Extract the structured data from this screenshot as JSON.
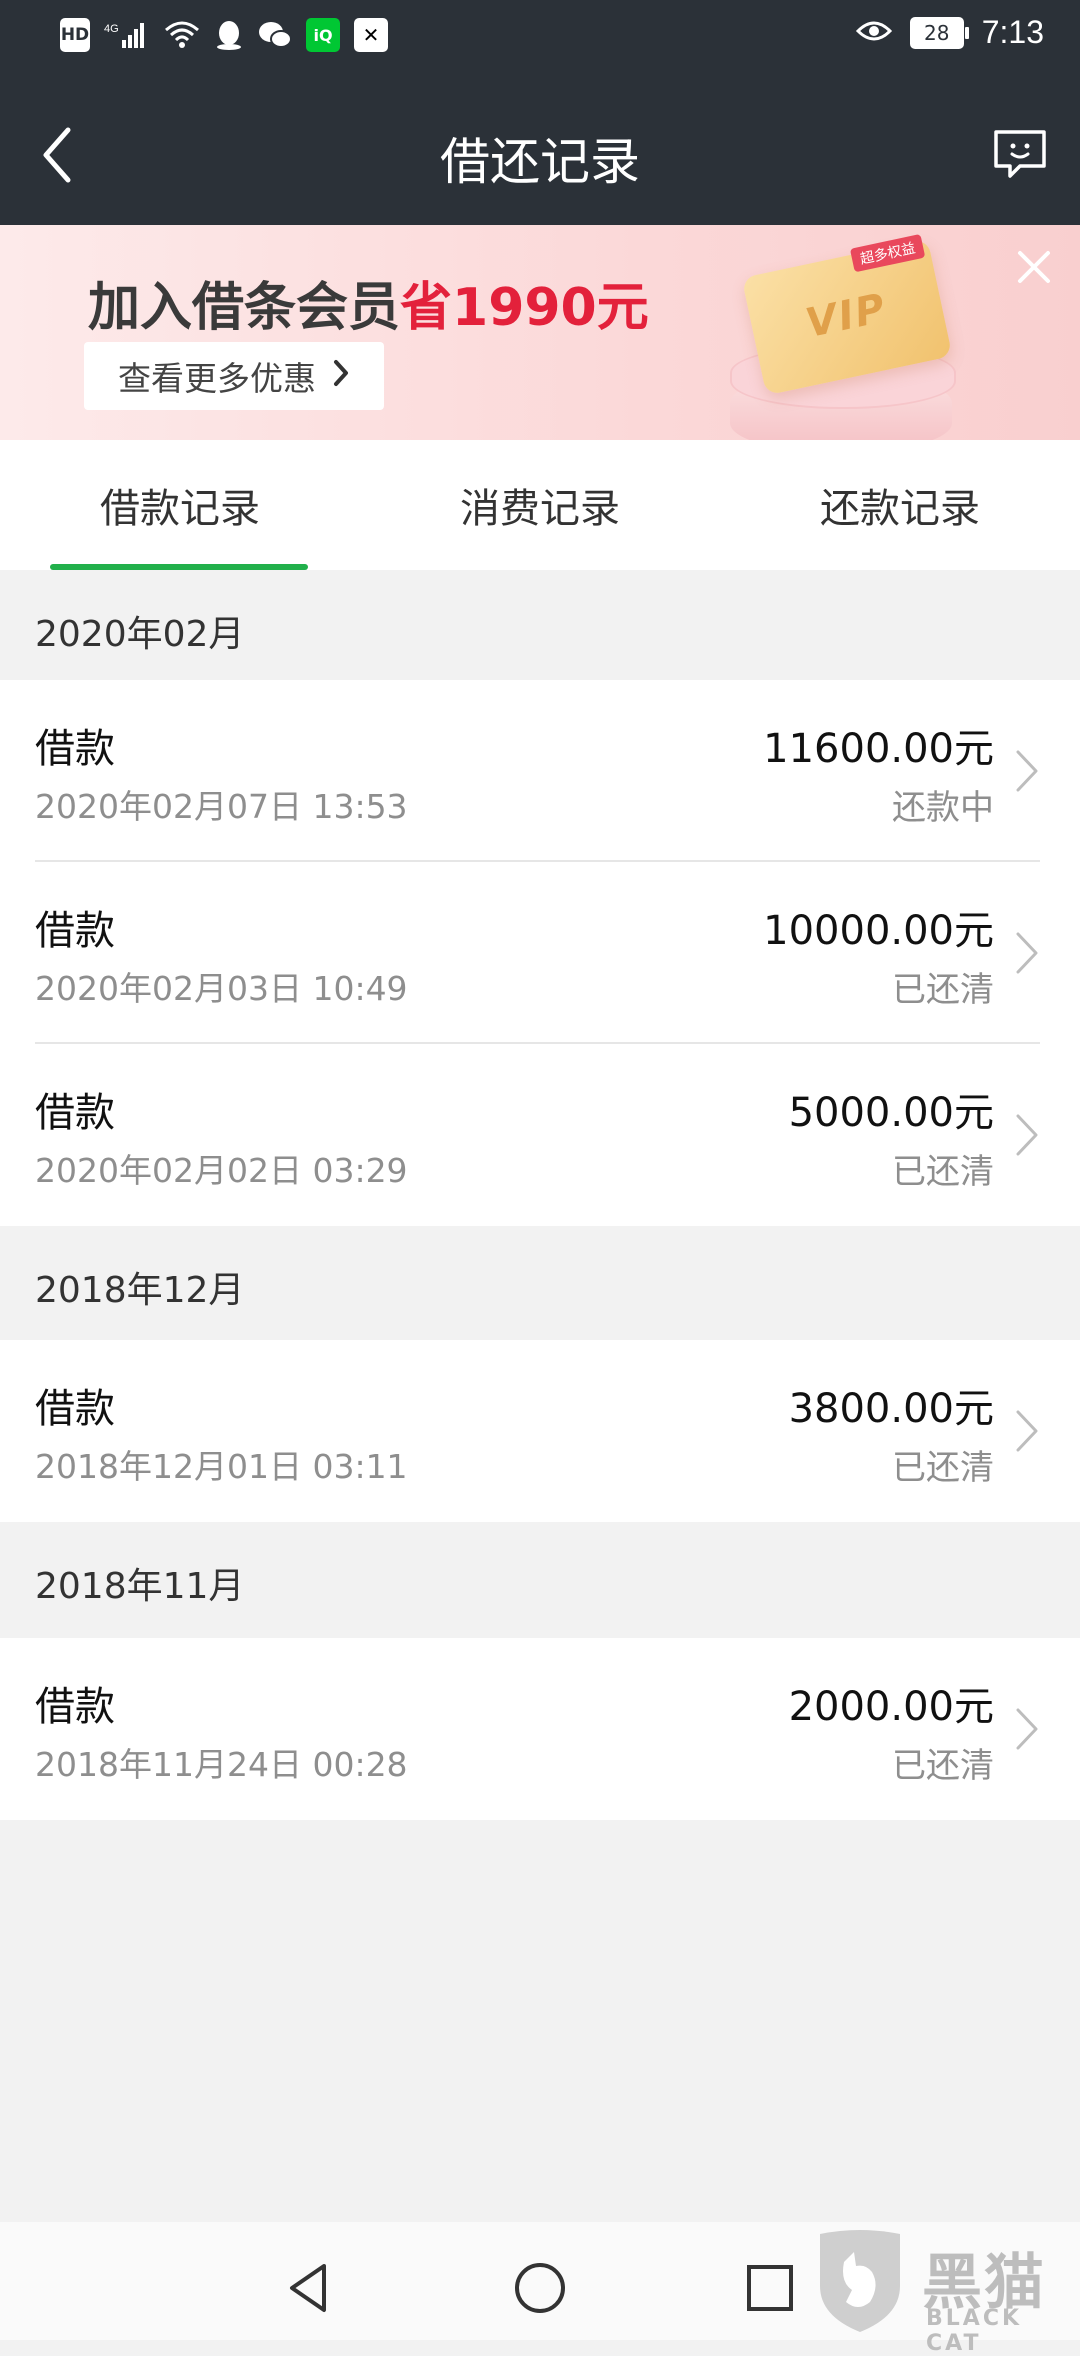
{
  "status_bar": {
    "hd": "HD",
    "network": "4G",
    "battery": "28",
    "time": "7:13"
  },
  "nav": {
    "title": "借还记录"
  },
  "banner": {
    "title_prefix": "加入借条会员",
    "title_highlight": "省1990元",
    "button_label": "查看更多优惠",
    "vip_tag": "超多权益",
    "vip_text": "VIP"
  },
  "tabs": [
    {
      "label": "借款记录",
      "active": true
    },
    {
      "label": "消费记录",
      "active": false
    },
    {
      "label": "还款记录",
      "active": false
    }
  ],
  "sections": [
    {
      "month": "2020年02月",
      "records": [
        {
          "type": "借款",
          "date": "2020年02月07日 13:53",
          "amount": "11600.00元",
          "status": "还款中"
        },
        {
          "type": "借款",
          "date": "2020年02月03日 10:49",
          "amount": "10000.00元",
          "status": "已还清"
        },
        {
          "type": "借款",
          "date": "2020年02月02日 03:29",
          "amount": "5000.00元",
          "status": "已还清"
        }
      ]
    },
    {
      "month": "2018年12月",
      "records": [
        {
          "type": "借款",
          "date": "2018年12月01日 03:11",
          "amount": "3800.00元",
          "status": "已还清"
        }
      ]
    },
    {
      "month": "2018年11月",
      "records": [
        {
          "type": "借款",
          "date": "2018年11月24日 00:28",
          "amount": "2000.00元",
          "status": "已还清"
        }
      ]
    }
  ],
  "watermark": {
    "cn": "黑猫",
    "en": "BLACK CAT"
  },
  "colors": {
    "header_bg": "#2b3138",
    "accent_green": "#21b04b",
    "highlight_red": "#e3213b"
  }
}
